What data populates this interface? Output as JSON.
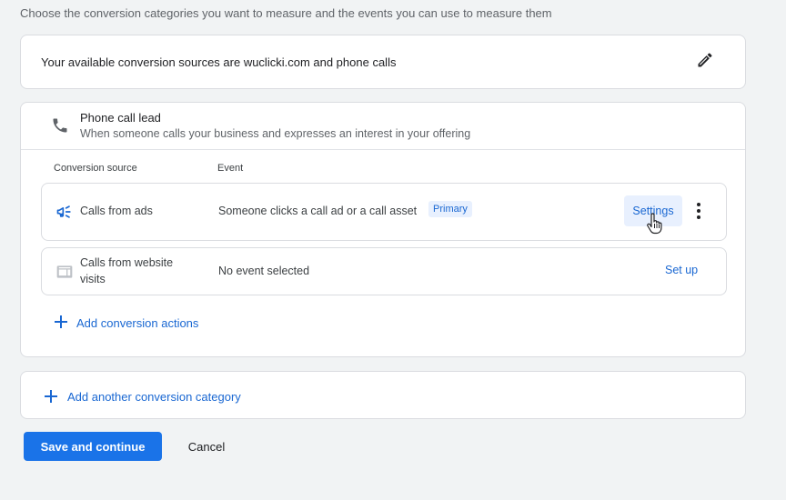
{
  "header": {
    "subtitle": "Choose the conversion categories you want to measure and the events you can use to measure them"
  },
  "sources": {
    "text": "Your available conversion sources are wuclicki.com and phone calls",
    "edit_icon": "pencil-icon"
  },
  "category": {
    "icon": "phone-icon",
    "title": "Phone call lead",
    "description": "When someone calls your business and expresses an interest in your offering",
    "columns": {
      "source": "Conversion source",
      "event": "Event"
    },
    "rows": [
      {
        "icon": "megaphone-icon",
        "source": "Calls from ads",
        "event": "Someone clicks a call ad or a call asset",
        "badge": "Primary",
        "action": "Settings",
        "more_icon": "more-vert-icon"
      },
      {
        "icon": "web-icon",
        "source": "Calls from website visits",
        "event": "No event selected",
        "action": "Set up"
      }
    ],
    "add_actions_label": "Add conversion actions"
  },
  "add_category_label": "Add another conversion category",
  "footer": {
    "save_label": "Save and continue",
    "cancel_label": "Cancel"
  },
  "colors": {
    "accent": "#1a73e8",
    "link": "#1967d2",
    "badge_bg": "#e8f0fe"
  }
}
